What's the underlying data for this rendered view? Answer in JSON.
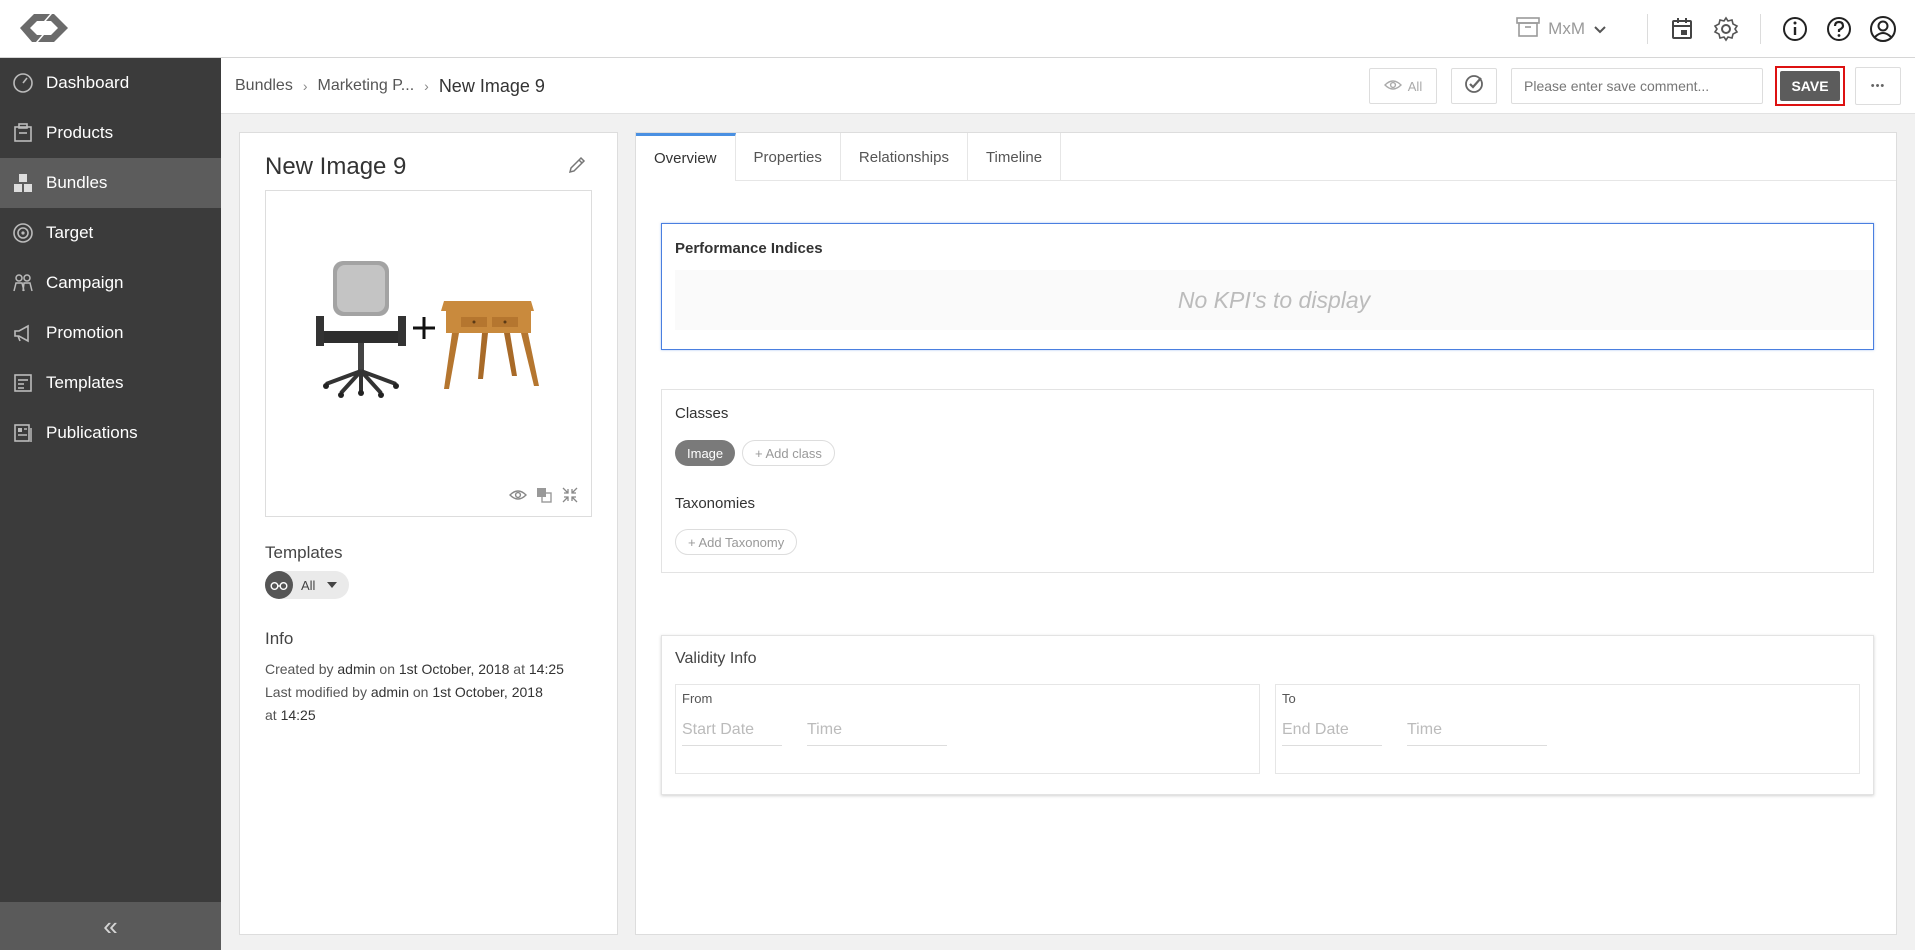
{
  "header": {
    "workspace": "MxM",
    "icons": [
      "logo-icon",
      "archive-icon",
      "chevron-down-icon",
      "calendar-icon",
      "gear-icon",
      "info-icon",
      "help-icon",
      "user-icon"
    ]
  },
  "sidebar": {
    "items": [
      {
        "label": "Dashboard",
        "icon": "gauge-icon",
        "active": false
      },
      {
        "label": "Products",
        "icon": "box-icon",
        "active": false
      },
      {
        "label": "Bundles",
        "icon": "cubes-icon",
        "active": true
      },
      {
        "label": "Target",
        "icon": "target-icon",
        "active": false
      },
      {
        "label": "Campaign",
        "icon": "people-icon",
        "active": false
      },
      {
        "label": "Promotion",
        "icon": "megaphone-icon",
        "active": false
      },
      {
        "label": "Templates",
        "icon": "templates-icon",
        "active": false
      },
      {
        "label": "Publications",
        "icon": "publications-icon",
        "active": false
      }
    ],
    "collapse_symbol": "«"
  },
  "breadcrumb": {
    "items": [
      "Bundles",
      "Marketing P..."
    ],
    "current": "New Image 9",
    "separator": "›"
  },
  "toolbar": {
    "visibility_label": "All",
    "comment_placeholder": "Please enter save comment...",
    "save_label": "SAVE",
    "more_label": "•••"
  },
  "item": {
    "title": "New Image 9",
    "templates_label": "Templates",
    "template_value": "All",
    "info_label": "Info",
    "created_prefix": "Created by",
    "created_user": "admin",
    "created_on": "on",
    "created_date": "1st October, 2018",
    "created_at": "at",
    "created_time": "14:25",
    "modified_prefix": "Last modified by",
    "modified_user": "admin",
    "modified_on": "on",
    "modified_date": "1st October, 2018",
    "modified_at": "at",
    "modified_time": "14:25"
  },
  "tabs": [
    {
      "label": "Overview",
      "active": true
    },
    {
      "label": "Properties",
      "active": false
    },
    {
      "label": "Relationships",
      "active": false
    },
    {
      "label": "Timeline",
      "active": false
    }
  ],
  "overview": {
    "kpi_title": "Performance Indices",
    "kpi_empty": "No KPI's to display",
    "classes_title": "Classes",
    "class_chip": "Image",
    "add_class": "+ Add class",
    "taxonomies_title": "Taxonomies",
    "add_taxonomy": "+ Add Taxonomy",
    "validity_title": "Validity Info",
    "from_label": "From",
    "start_date_placeholder": "Start Date",
    "from_time_placeholder": "Time",
    "to_label": "To",
    "end_date_placeholder": "End Date",
    "to_time_placeholder": "Time"
  },
  "colors": {
    "sidebar_bg": "#3b3b3b",
    "sidebar_active": "#5c5c5c",
    "accent_blue": "#4a90e2",
    "save_bg": "#5c5c5c",
    "highlight_red": "#dd1111"
  }
}
